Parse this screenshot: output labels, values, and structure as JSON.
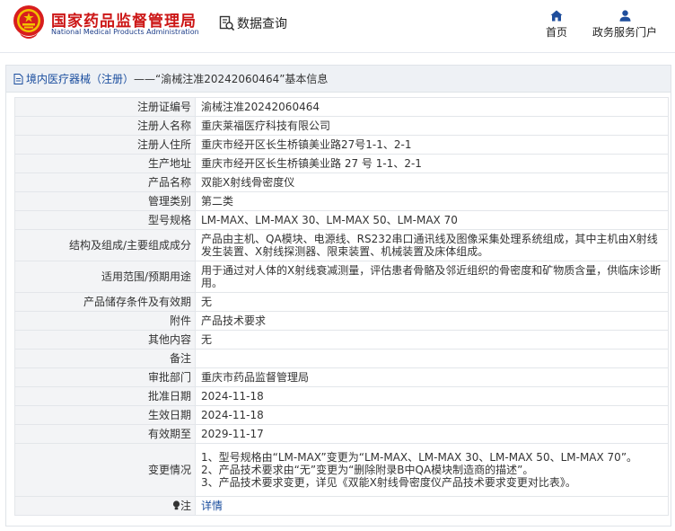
{
  "header": {
    "logo_cn": "国家药品监督管理局",
    "logo_en": "National Medical Products Administration",
    "search_label": "数据查询",
    "nav": {
      "home": "首页",
      "portal": "政务服务门户"
    },
    "brand_color": "#cc1616",
    "accent_color": "#1a4d9e"
  },
  "panel": {
    "title_prefix": "境内医疗器械（注册）",
    "title_sep": " —— ",
    "title_main": "“渝械注准20242060464”基本信息"
  },
  "rows": [
    {
      "key": "注册证编号",
      "value": "渝械注准20242060464"
    },
    {
      "key": "注册人名称",
      "value": "重庆莱福医疗科技有限公司"
    },
    {
      "key": "注册人住所",
      "value": "重庆市经开区长生桥镇美业路27号1-1、2-1"
    },
    {
      "key": "生产地址",
      "value": "重庆市经开区长生桥镇美业路 27 号 1-1、2-1"
    },
    {
      "key": "产品名称",
      "value": "双能X射线骨密度仪"
    },
    {
      "key": "管理类别",
      "value": "第二类"
    },
    {
      "key": "型号规格",
      "value": "LM-MAX、LM-MAX 30、LM-MAX 50、LM-MAX 70"
    },
    {
      "key": "结构及组成/主要组成成分",
      "value": "产品由主机、QA模块、电源线、RS232串口通讯线及图像采集处理系统组成，其中主机由X射线发生装置、X射线探测器、限束装置、机械装置及床体组成。"
    },
    {
      "key": "适用范围/预期用途",
      "value": "用于通过对人体的X射线衰减测量，评估患者骨骼及邻近组织的骨密度和矿物质含量，供临床诊断用。"
    },
    {
      "key": "产品储存条件及有效期",
      "value": "无"
    },
    {
      "key": "附件",
      "value": "产品技术要求"
    },
    {
      "key": "其他内容",
      "value": "无"
    },
    {
      "key": "备注",
      "value": ""
    },
    {
      "key": "审批部门",
      "value": "重庆市药品监督管理局"
    },
    {
      "key": "批准日期",
      "value": "2024-11-18"
    },
    {
      "key": "生效日期",
      "value": "2024-11-18"
    },
    {
      "key": "有效期至",
      "value": "2029-11-17"
    }
  ],
  "change": {
    "key": "变更情况",
    "lines": [
      "1、型号规格由“LM-MAX”变更为“LM-MAX、LM-MAX 30、LM-MAX 50、LM-MAX 70”。",
      "2、产品技术要求由“无”变更为“删除附录B中QA模块制造商的描述”。",
      "3、产品技术要求变更，详见《双能X射线骨密度仪产品技术要求变更对比表》。"
    ]
  },
  "note": {
    "key": "注",
    "link": "详情",
    "icon": "bulb-icon"
  }
}
